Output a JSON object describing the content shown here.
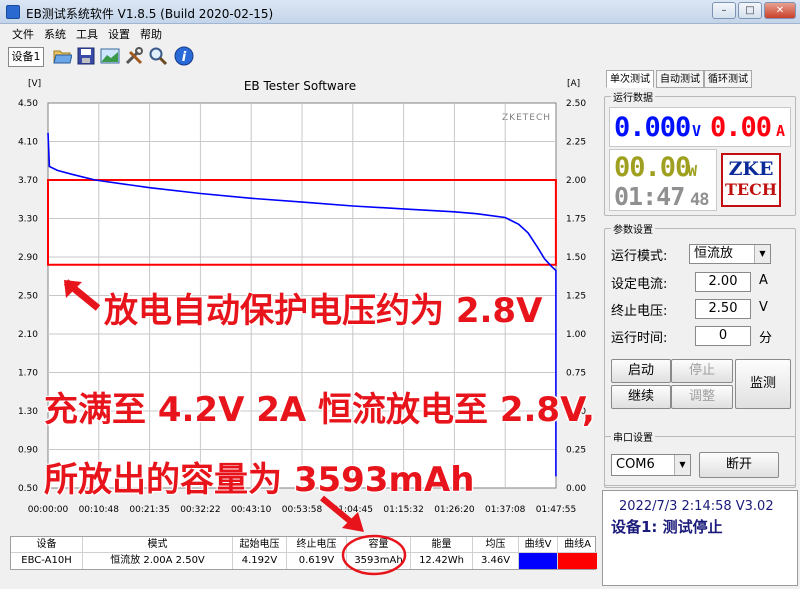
{
  "window": {
    "title": "EB测试系统软件 V1.8.5 (Build 2020-02-15)",
    "minimize": "–",
    "maximize": "□",
    "close": "✕"
  },
  "menu": [
    "文件",
    "系统",
    "工具",
    "设置",
    "帮助"
  ],
  "toolbar": {
    "device_tab": "设备1"
  },
  "chart": {
    "title": "EB Tester Software",
    "watermark": "ZKETECH",
    "left_unit": "[V]",
    "right_unit": "[A]",
    "left_ticks": [
      "4.50",
      "4.10",
      "3.70",
      "3.30",
      "2.90",
      "2.50",
      "2.10",
      "1.70",
      "1.30",
      "0.90",
      "0.50"
    ],
    "right_ticks": [
      "2.50",
      "2.25",
      "2.00",
      "1.75",
      "1.50",
      "1.25",
      "1.00",
      "0.75",
      "0.50",
      "0.25",
      "0.00"
    ],
    "x_ticks": [
      "00:00:00",
      "00:10:48",
      "00:21:35",
      "00:32:22",
      "00:43:10",
      "00:53:58",
      "01:04:45",
      "01:15:32",
      "01:26:20",
      "01:37:08",
      "01:47:55"
    ]
  },
  "chart_data": {
    "type": "line",
    "title": "EB Tester Software",
    "xlabel": "",
    "ylabel": "[V]",
    "y2label": "[A]",
    "ylim": [
      0.5,
      4.5
    ],
    "y2lim": [
      0,
      2.5
    ],
    "x": [
      "00:00:00",
      "00:10:48",
      "00:21:35",
      "00:32:22",
      "00:43:10",
      "00:53:58",
      "01:04:45",
      "01:15:32",
      "01:26:20",
      "01:37:08",
      "01:47:55"
    ],
    "series": [
      {
        "name": "曲线V",
        "color": "#0000ff",
        "points": [
          [
            0,
            4.19
          ],
          [
            0.3,
            3.84
          ],
          [
            2,
            3.8
          ],
          [
            5,
            3.76
          ],
          [
            10,
            3.7
          ],
          [
            21.6,
            3.62
          ],
          [
            32.4,
            3.56
          ],
          [
            43.2,
            3.51
          ],
          [
            54,
            3.47
          ],
          [
            64.8,
            3.43
          ],
          [
            75.5,
            3.4
          ],
          [
            86.3,
            3.37
          ],
          [
            91,
            3.35
          ],
          [
            97.1,
            3.31
          ],
          [
            100,
            3.24
          ],
          [
            102,
            3.15
          ],
          [
            104,
            3.0
          ],
          [
            105.5,
            2.88
          ],
          [
            107,
            2.8
          ],
          [
            107.9,
            2.76
          ],
          [
            107.9,
            0.62
          ]
        ]
      },
      {
        "name": "曲线A",
        "color": "#ff0000",
        "points": [
          [
            0,
            2.0
          ],
          [
            107.9,
            2.0
          ],
          [
            107.9,
            1.45
          ],
          [
            0,
            1.45
          ]
        ]
      }
    ],
    "grid": true
  },
  "annotations": {
    "line1": "放电自动保护电压约为 2.8V",
    "line2": "充满至 4.2V 2A 恒流放电至 2.8V,",
    "line3": "所放出的容量为 3593mAh"
  },
  "table": {
    "headers": [
      "设备",
      "模式",
      "起始电压",
      "终止电压",
      "容量",
      "能量",
      "均压",
      "曲线V",
      "曲线A"
    ],
    "row": [
      "EBC-A10H",
      "恒流放 2.00A 2.50V",
      "4.192V",
      "0.619V",
      "3593mAh",
      "12.42Wh",
      "3.46V",
      "",
      ""
    ],
    "curve_v_color": "#0000ff",
    "curve_a_color": "#ff0000"
  },
  "panel": {
    "tabs": [
      "单次测试",
      "自动测试",
      "循环测试"
    ],
    "run_data_title": "运行数据",
    "voltage": "0.000",
    "voltage_unit": "V",
    "current": "0.00",
    "current_unit": "A",
    "power": "00.00",
    "power_unit": "W",
    "time": "01:47",
    "time_sec": "48",
    "logo_top": "ZKE",
    "logo_bottom": "TECH",
    "params_title": "参数设置",
    "mode_label": "运行模式:",
    "mode_value": "恒流放",
    "current_label": "设定电流:",
    "current_value": "2.00",
    "current_set_unit": "A",
    "stop_label": "终止电压:",
    "stop_value": "2.50",
    "stop_unit": "V",
    "runtime_label": "运行时间:",
    "runtime_value": "0",
    "runtime_unit": "分",
    "btn_start": "启动",
    "btn_stop": "停止",
    "btn_continue": "继续",
    "btn_adjust": "调整",
    "btn_monitor": "监测",
    "serial_title": "串口设置",
    "port": "COM6",
    "btn_disconnect": "断开",
    "status_line1": "2022/7/3 2:14:58  V3.02",
    "status_line2": "设备1: 测试停止"
  }
}
